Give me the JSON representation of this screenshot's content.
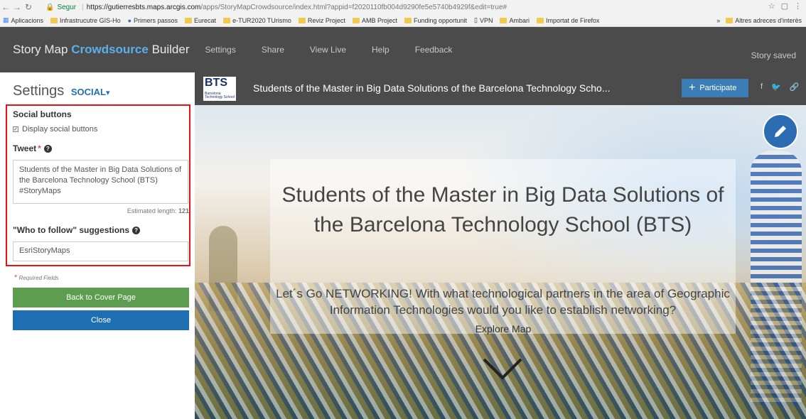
{
  "browser": {
    "secure_label": "Segur",
    "url_host": "https://gutierresbts.maps.arcgis.com",
    "url_path": "/apps/StoryMapCrowdsource/index.html?appid=f2020110fb004d9290fe5e5740b4929f&edit=true#",
    "bookmarks": [
      "Aplicacions",
      "Infrastrucutre GIS-Ho",
      "Primers passos",
      "Eurecat",
      "e-TUR2020 TUrismo",
      "Reviz Project",
      "AMB Project",
      "Funding opportunit",
      "VPN",
      "Ambari",
      "Importat de Firefox"
    ],
    "other_bookmarks": "Altres adreces d'interès"
  },
  "builder": {
    "title_start": "Story Map ",
    "title_accent": "Crowdsource",
    "title_end": " Builder",
    "menu": [
      "Settings",
      "Share",
      "View Live",
      "Help",
      "Feedback"
    ],
    "status": "Story saved"
  },
  "settings": {
    "title": "Settings",
    "section": "SOCIAL",
    "social_buttons_heading": "Social buttons",
    "display_social_label": "Display social buttons",
    "tweet_label": "Tweet",
    "tweet_text": "Students of the Master in Big Data Solutions of the Barcelona Technology School (BTS)  #StoryMaps",
    "estimated_length_label": "Estimated length:",
    "estimated_length_value": "121",
    "follow_label": "\"Who to follow\" suggestions",
    "follow_value": "EsriStoryMaps",
    "required_note": "Required Fields",
    "back_button": "Back to Cover Page",
    "close_button": "Close"
  },
  "app": {
    "logo_text": "BTS",
    "logo_sub": "Barcelona Technology School",
    "title": "Students of the Master in Big Data Solutions of the Barcelona Technology Scho...",
    "participate_button": "Participate",
    "cover_title": "Students of the Master in Big Data Solutions of the Barcelona Technology School (BTS)",
    "cover_subtitle": "Let´s Go NETWORKING! With what technological partners in the area of Geographic Information Technologies would you like to establish networking?",
    "explore_label": "Explore Map"
  },
  "colors": {
    "accent_blue": "#1e6fb1",
    "builder_bg": "#4b4b4b",
    "green_button": "#5c9d50",
    "highlight_red": "#ee1111"
  }
}
